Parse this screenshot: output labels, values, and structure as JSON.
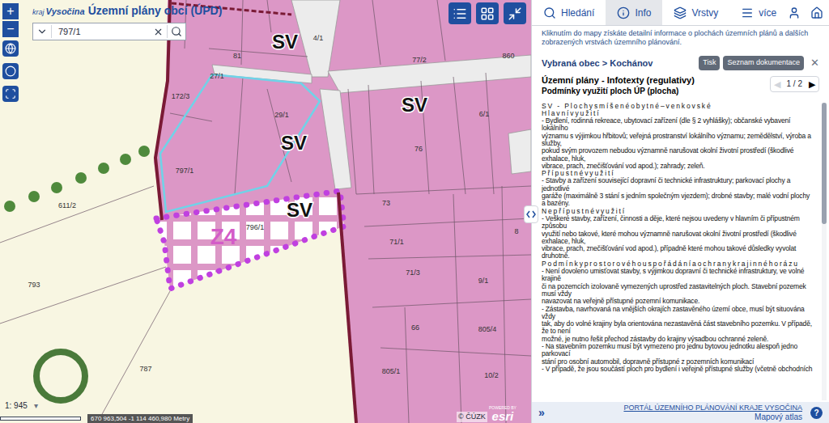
{
  "header": {
    "logo_prefix": "kraj",
    "logo_name": "Vysočina",
    "title": "Územní plány obcí (ÚPD)"
  },
  "search": {
    "value": "797/1"
  },
  "zoom": {
    "in": "+",
    "out": "−"
  },
  "map": {
    "zones": [
      {
        "text": "SV"
      },
      {
        "text": "SV"
      },
      {
        "text": "SV"
      },
      {
        "text": "SV"
      }
    ],
    "proposal": "Z4",
    "parcels": [
      {
        "text": "4/1"
      },
      {
        "text": "81"
      },
      {
        "text": "27/1"
      },
      {
        "text": "172/3"
      },
      {
        "text": "77/2"
      },
      {
        "text": "860"
      },
      {
        "text": "29/1"
      },
      {
        "text": "76"
      },
      {
        "text": "6/1"
      },
      {
        "text": "797/1"
      },
      {
        "text": "611/2"
      },
      {
        "text": "73"
      },
      {
        "text": "796/1"
      },
      {
        "text": "71/1"
      },
      {
        "text": "8"
      },
      {
        "text": "71/3"
      },
      {
        "text": "9/1"
      },
      {
        "text": "793"
      },
      {
        "text": "66"
      },
      {
        "text": "805/4"
      },
      {
        "text": "787"
      },
      {
        "text": "805/1"
      },
      {
        "text": "10/2"
      }
    ]
  },
  "status": {
    "scale": "1: 945",
    "scale_arrow": "▾",
    "coordinates": "670 963,504 -1 114 460,980 Metry",
    "copyright": "© ČÚZK",
    "esri_powered": "POWERED BY",
    "esri": "esri"
  },
  "panel": {
    "tabs": [
      {
        "label": "Hledání",
        "selected": false
      },
      {
        "label": "Info",
        "selected": true
      },
      {
        "label": "Vrstvy",
        "selected": false
      },
      {
        "label": "více",
        "selected": false
      }
    ],
    "intro": "Kliknutím do mapy získáte detailní informace o plochách územních plánů a dalších zobrazených vrstvách územního plánování.",
    "breadcrumb": "Vybraná obec > Kochánov",
    "buttons": [
      "Tisk",
      "Seznam dokumentace"
    ],
    "close": "✕",
    "title": "Územní plány - Infotexty (regulativy)",
    "subtitle": "Podmínky využití ploch ÚP (plocha)",
    "pager": {
      "prev": "◀",
      "prev_disabled": true,
      "page": "1 / 2",
      "next": "▶",
      "next_disabled": false
    },
    "lines": [
      {
        "kind": "heading",
        "text": "SV - Plochysmíšenéobytné–venkovské"
      },
      {
        "kind": "heading",
        "text": "Hlavnívyužití"
      },
      {
        "kind": "text",
        "text": "- Bydlení, rodinná rekreace, ubytovací zařízení (dle § 2 vyhlášky); občanské vybavení"
      },
      {
        "kind": "text",
        "text": "lokálního"
      },
      {
        "kind": "text",
        "text": "významu s výjimkou hřbitovů; veřejná prostranství lokálního významu; zemědělství, výroba a"
      },
      {
        "kind": "text",
        "text": "služby,"
      },
      {
        "kind": "text",
        "text": "pokud svým provozem nebudou významně narušovat okolní životní prostředí (škodlivé"
      },
      {
        "kind": "text",
        "text": "exhalace, hluk,"
      },
      {
        "kind": "text",
        "text": "vibrace, prach, znečišťování vod apod.); zahrady; zeleň."
      },
      {
        "kind": "heading",
        "text": "Přípustnévyužití"
      },
      {
        "kind": "text",
        "text": "- Stavby a zařízení související dopravní či technické infrastruktury; parkovací plochy a"
      },
      {
        "kind": "text",
        "text": "jednotlivé"
      },
      {
        "kind": "text",
        "text": "garáže (maximálně 3 stání s jedním společným vjezdem); drobné stavby; malé vodní plochy"
      },
      {
        "kind": "text",
        "text": "a bazény."
      },
      {
        "kind": "heading",
        "text": "Nepřípustnévyužití"
      },
      {
        "kind": "text",
        "text": "- Veškeré stavby, zařízení, činnosti a děje, které nejsou uvedeny v hlavním či přípustném"
      },
      {
        "kind": "text",
        "text": "způsobu"
      },
      {
        "kind": "text",
        "text": "využití nebo takové, které mohou významně narušovat okolní životní prostředí (škodlivé"
      },
      {
        "kind": "text",
        "text": "exhalace, hluk,"
      },
      {
        "kind": "text",
        "text": "vibrace, prach, znečišťování vod apod.), případně které mohou takové důsledky vyvolat"
      },
      {
        "kind": "text",
        "text": "druhotně."
      },
      {
        "kind": "heading",
        "text": "Podmínkyprostorovéhouspořádáníaochranykrajinnéhorázu"
      },
      {
        "kind": "text",
        "text": "- Není dovoleno umisťovat stavby, s výjimkou dopravní či technické infrastruktury, ve volné"
      },
      {
        "kind": "text",
        "text": "krajině"
      },
      {
        "kind": "text",
        "text": "či na pozemcích izolovaně vymezených uprostřed zastavitelných ploch. Stavební pozemek"
      },
      {
        "kind": "text",
        "text": "musí vždy"
      },
      {
        "kind": "text",
        "text": "navazovat na veřejně přístupné pozemní komunikace."
      },
      {
        "kind": "text",
        "text": "- Zástavba, navrhovaná na vnějších okrajích zastavěného území obce, musí být situována"
      },
      {
        "kind": "text",
        "text": "vždy"
      },
      {
        "kind": "text",
        "text": "tak, aby do volné krajiny byla orientována nezastavěná část stavebního pozemku. V případě,"
      },
      {
        "kind": "text",
        "text": "že to není"
      },
      {
        "kind": "text",
        "text": "možné, je nutno řešit přechod zástavby do krajiny výsadbou ochranné zeleně."
      },
      {
        "kind": "text",
        "text": "- Na stavebním pozemku musí být vymezeno pro jednu bytovou jednotku alespoň jedno"
      },
      {
        "kind": "text",
        "text": "parkovací"
      },
      {
        "kind": "text",
        "text": "stání pro osobní automobil, dopravně přístupné z pozemních komunikací"
      },
      {
        "kind": "text",
        "text": "- V případě, že jsou součástí ploch pro bydlení i veřejně přístupné služby (včetně obchodních"
      }
    ]
  },
  "footer": {
    "collapse": "»",
    "link": "PORTÁL ÚZEMNÍHO PLÁNOVÁNÍ KRAJE VYSOČINA",
    "atlas": "Mapový atlas",
    "help": "?"
  }
}
